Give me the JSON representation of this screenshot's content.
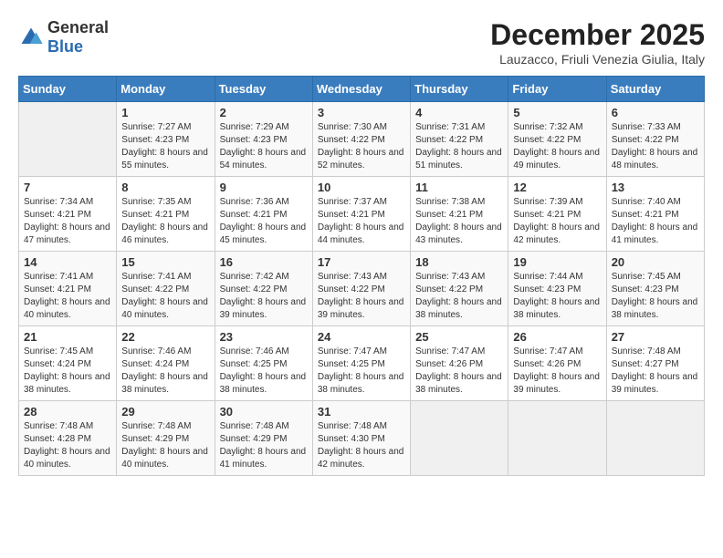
{
  "logo": {
    "general": "General",
    "blue": "Blue"
  },
  "title": "December 2025",
  "subtitle": "Lauzacco, Friuli Venezia Giulia, Italy",
  "weekdays": [
    "Sunday",
    "Monday",
    "Tuesday",
    "Wednesday",
    "Thursday",
    "Friday",
    "Saturday"
  ],
  "weeks": [
    [
      {
        "day": "",
        "sunrise": "",
        "sunset": "",
        "daylight": ""
      },
      {
        "day": "1",
        "sunrise": "Sunrise: 7:27 AM",
        "sunset": "Sunset: 4:23 PM",
        "daylight": "Daylight: 8 hours and 55 minutes."
      },
      {
        "day": "2",
        "sunrise": "Sunrise: 7:29 AM",
        "sunset": "Sunset: 4:23 PM",
        "daylight": "Daylight: 8 hours and 54 minutes."
      },
      {
        "day": "3",
        "sunrise": "Sunrise: 7:30 AM",
        "sunset": "Sunset: 4:22 PM",
        "daylight": "Daylight: 8 hours and 52 minutes."
      },
      {
        "day": "4",
        "sunrise": "Sunrise: 7:31 AM",
        "sunset": "Sunset: 4:22 PM",
        "daylight": "Daylight: 8 hours and 51 minutes."
      },
      {
        "day": "5",
        "sunrise": "Sunrise: 7:32 AM",
        "sunset": "Sunset: 4:22 PM",
        "daylight": "Daylight: 8 hours and 49 minutes."
      },
      {
        "day": "6",
        "sunrise": "Sunrise: 7:33 AM",
        "sunset": "Sunset: 4:22 PM",
        "daylight": "Daylight: 8 hours and 48 minutes."
      }
    ],
    [
      {
        "day": "7",
        "sunrise": "Sunrise: 7:34 AM",
        "sunset": "Sunset: 4:21 PM",
        "daylight": "Daylight: 8 hours and 47 minutes."
      },
      {
        "day": "8",
        "sunrise": "Sunrise: 7:35 AM",
        "sunset": "Sunset: 4:21 PM",
        "daylight": "Daylight: 8 hours and 46 minutes."
      },
      {
        "day": "9",
        "sunrise": "Sunrise: 7:36 AM",
        "sunset": "Sunset: 4:21 PM",
        "daylight": "Daylight: 8 hours and 45 minutes."
      },
      {
        "day": "10",
        "sunrise": "Sunrise: 7:37 AM",
        "sunset": "Sunset: 4:21 PM",
        "daylight": "Daylight: 8 hours and 44 minutes."
      },
      {
        "day": "11",
        "sunrise": "Sunrise: 7:38 AM",
        "sunset": "Sunset: 4:21 PM",
        "daylight": "Daylight: 8 hours and 43 minutes."
      },
      {
        "day": "12",
        "sunrise": "Sunrise: 7:39 AM",
        "sunset": "Sunset: 4:21 PM",
        "daylight": "Daylight: 8 hours and 42 minutes."
      },
      {
        "day": "13",
        "sunrise": "Sunrise: 7:40 AM",
        "sunset": "Sunset: 4:21 PM",
        "daylight": "Daylight: 8 hours and 41 minutes."
      }
    ],
    [
      {
        "day": "14",
        "sunrise": "Sunrise: 7:41 AM",
        "sunset": "Sunset: 4:21 PM",
        "daylight": "Daylight: 8 hours and 40 minutes."
      },
      {
        "day": "15",
        "sunrise": "Sunrise: 7:41 AM",
        "sunset": "Sunset: 4:22 PM",
        "daylight": "Daylight: 8 hours and 40 minutes."
      },
      {
        "day": "16",
        "sunrise": "Sunrise: 7:42 AM",
        "sunset": "Sunset: 4:22 PM",
        "daylight": "Daylight: 8 hours and 39 minutes."
      },
      {
        "day": "17",
        "sunrise": "Sunrise: 7:43 AM",
        "sunset": "Sunset: 4:22 PM",
        "daylight": "Daylight: 8 hours and 39 minutes."
      },
      {
        "day": "18",
        "sunrise": "Sunrise: 7:43 AM",
        "sunset": "Sunset: 4:22 PM",
        "daylight": "Daylight: 8 hours and 38 minutes."
      },
      {
        "day": "19",
        "sunrise": "Sunrise: 7:44 AM",
        "sunset": "Sunset: 4:23 PM",
        "daylight": "Daylight: 8 hours and 38 minutes."
      },
      {
        "day": "20",
        "sunrise": "Sunrise: 7:45 AM",
        "sunset": "Sunset: 4:23 PM",
        "daylight": "Daylight: 8 hours and 38 minutes."
      }
    ],
    [
      {
        "day": "21",
        "sunrise": "Sunrise: 7:45 AM",
        "sunset": "Sunset: 4:24 PM",
        "daylight": "Daylight: 8 hours and 38 minutes."
      },
      {
        "day": "22",
        "sunrise": "Sunrise: 7:46 AM",
        "sunset": "Sunset: 4:24 PM",
        "daylight": "Daylight: 8 hours and 38 minutes."
      },
      {
        "day": "23",
        "sunrise": "Sunrise: 7:46 AM",
        "sunset": "Sunset: 4:25 PM",
        "daylight": "Daylight: 8 hours and 38 minutes."
      },
      {
        "day": "24",
        "sunrise": "Sunrise: 7:47 AM",
        "sunset": "Sunset: 4:25 PM",
        "daylight": "Daylight: 8 hours and 38 minutes."
      },
      {
        "day": "25",
        "sunrise": "Sunrise: 7:47 AM",
        "sunset": "Sunset: 4:26 PM",
        "daylight": "Daylight: 8 hours and 38 minutes."
      },
      {
        "day": "26",
        "sunrise": "Sunrise: 7:47 AM",
        "sunset": "Sunset: 4:26 PM",
        "daylight": "Daylight: 8 hours and 39 minutes."
      },
      {
        "day": "27",
        "sunrise": "Sunrise: 7:48 AM",
        "sunset": "Sunset: 4:27 PM",
        "daylight": "Daylight: 8 hours and 39 minutes."
      }
    ],
    [
      {
        "day": "28",
        "sunrise": "Sunrise: 7:48 AM",
        "sunset": "Sunset: 4:28 PM",
        "daylight": "Daylight: 8 hours and 40 minutes."
      },
      {
        "day": "29",
        "sunrise": "Sunrise: 7:48 AM",
        "sunset": "Sunset: 4:29 PM",
        "daylight": "Daylight: 8 hours and 40 minutes."
      },
      {
        "day": "30",
        "sunrise": "Sunrise: 7:48 AM",
        "sunset": "Sunset: 4:29 PM",
        "daylight": "Daylight: 8 hours and 41 minutes."
      },
      {
        "day": "31",
        "sunrise": "Sunrise: 7:48 AM",
        "sunset": "Sunset: 4:30 PM",
        "daylight": "Daylight: 8 hours and 42 minutes."
      },
      {
        "day": "",
        "sunrise": "",
        "sunset": "",
        "daylight": ""
      },
      {
        "day": "",
        "sunrise": "",
        "sunset": "",
        "daylight": ""
      },
      {
        "day": "",
        "sunrise": "",
        "sunset": "",
        "daylight": ""
      }
    ]
  ]
}
